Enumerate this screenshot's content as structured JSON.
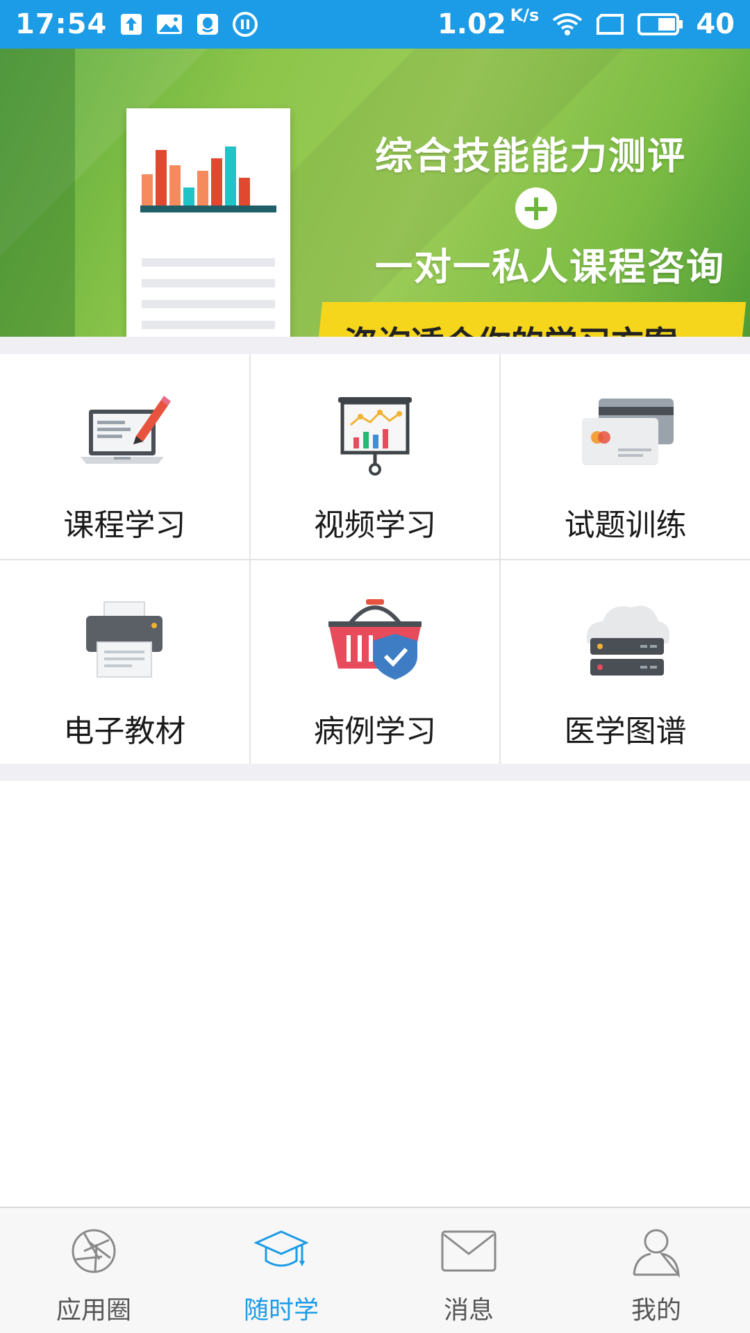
{
  "status_bar": {
    "time": "17:54",
    "speed": "1.02",
    "speed_unit": "K/s",
    "battery": "40",
    "icons": [
      "upload-icon",
      "image-icon",
      "qq-icon",
      "pause-icon",
      "wifi-icon",
      "sim-icon",
      "battery-icon"
    ]
  },
  "banner": {
    "line1": "综合技能能力测评",
    "plus": "+",
    "line2": "一对一私人课程咨询",
    "strip_text": "咨询适合你的学习方案"
  },
  "grid": {
    "items": [
      {
        "label": "课程学习",
        "icon": "laptop-pen-icon"
      },
      {
        "label": "视频学习",
        "icon": "presentation-board-icon"
      },
      {
        "label": "试题训练",
        "icon": "cards-icon"
      },
      {
        "label": "电子教材",
        "icon": "printer-icon"
      },
      {
        "label": "病例学习",
        "icon": "basket-shield-icon"
      },
      {
        "label": "医学图谱",
        "icon": "cloud-server-icon"
      }
    ]
  },
  "bottom_nav": {
    "items": [
      {
        "label": "应用圈",
        "icon": "aperture-icon",
        "active": false
      },
      {
        "label": "随时学",
        "icon": "graduation-cap-icon",
        "active": true
      },
      {
        "label": "消息",
        "icon": "envelope-icon",
        "active": false
      },
      {
        "label": "我的",
        "icon": "person-icon",
        "active": false
      }
    ]
  },
  "colors": {
    "accent": "#1c9be6",
    "banner_green": "#8cc54a",
    "banner_yellow": "#f6d61c"
  }
}
